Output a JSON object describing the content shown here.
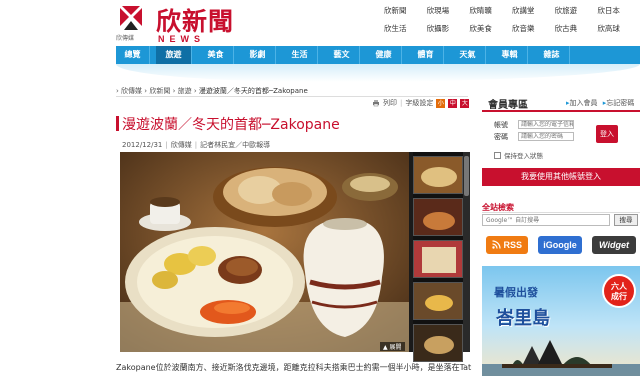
{
  "header": {
    "logo_text": "欣新聞",
    "logo_sub": "欣傳媒",
    "logo_en": "NEWS",
    "top_links": [
      "欣新聞",
      "欣現場",
      "欣睛曠",
      "欣講堂",
      "欣旅遊",
      "欣日本",
      "欣生活",
      "欣攝影",
      "欣美食",
      "欣音樂",
      "欣古典",
      "欣高球"
    ]
  },
  "nav": {
    "items": [
      "總覽",
      "旅遊",
      "美食",
      "影劇",
      "生活",
      "藝文",
      "健康",
      "體育",
      "天氣",
      "專輯",
      "雜誌"
    ],
    "active_index": 1
  },
  "breadcrumb": {
    "items": [
      "欣傳媒",
      "欣新聞",
      "旅遊",
      "漫遊波蘭／冬天的首都─Zakopane"
    ],
    "separator": "›"
  },
  "tools": {
    "print": "列印",
    "font_size": "字級設定",
    "sizes": [
      "小",
      "中",
      "大"
    ]
  },
  "article": {
    "title": "漫遊波蘭／冬天的首都─Zakopane",
    "date": "2012/12/31",
    "source": "欣傳媒",
    "author": "記者林民宜／中歐報導",
    "photo_caption_btn": "▲ 展開",
    "body_first_line": "Zakopane位於波蘭南方、接近斯洛伐克邊境，距離克拉科夫搭乘巴士約需一個半小時，是坐落在Tatra"
  },
  "member": {
    "title": "會員專區",
    "join": "加入會員",
    "forgot": "忘記密碼",
    "account_label": "帳號",
    "account_placeholder": "請輸入您的電子信箱",
    "password_label": "密碼",
    "password_placeholder": "請輸入您的密碼",
    "login": "登入",
    "remember": "保持登入狀態",
    "other_login": "我要使用其他帳號登入"
  },
  "search": {
    "title": "全站檢索",
    "placeholder": "Google™ 自訂搜尋",
    "button": "搜尋"
  },
  "feeds": {
    "rss": "RSS",
    "igoogle": "iGoogle",
    "widget": "Widget"
  },
  "ad": {
    "headline": "暑假出發",
    "place": "峇里島",
    "badge_line1": "六人",
    "badge_line2": "成行"
  },
  "colors": {
    "brand_red": "#c8102e",
    "nav_blue": "#1d97d6",
    "nav_active": "#0f6fa5"
  }
}
